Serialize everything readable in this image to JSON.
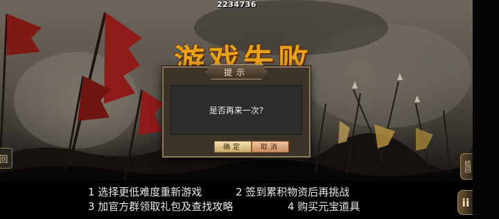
{
  "hud": {
    "score": "2234736"
  },
  "background": {
    "title_text": "游戏失败"
  },
  "dialog": {
    "title": "提示",
    "message": "是否再来一次?",
    "confirm_label": "确定",
    "cancel_label": "取消"
  },
  "tips": [
    "1 选择更低难度重新游戏",
    "2 签到累积物资后再挑战",
    "3 加官方群领取礼包及查找攻略",
    "4 购买元宝道具"
  ],
  "side_buttons": {
    "left_icon": "book-icon",
    "left_glyph": "回",
    "right_top_label": "结回",
    "right_bottom_glyph": "ii"
  },
  "colors": {
    "title_gold": "#e8a21c",
    "flag_red": "#8e1b17",
    "confirm_button": "#f3e2b0",
    "cancel_button": "#f0c6a2"
  }
}
